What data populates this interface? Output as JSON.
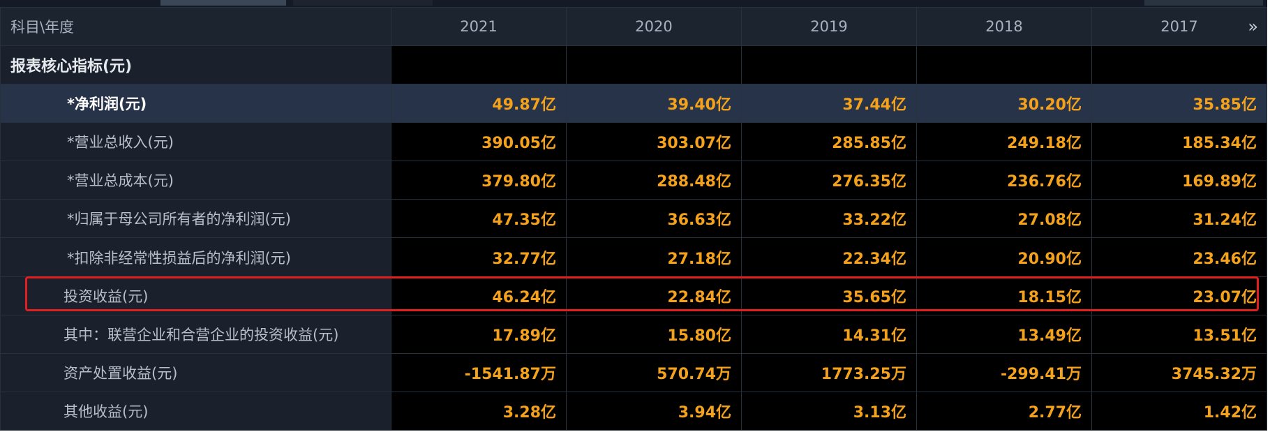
{
  "table": {
    "header_label": "科目\\年度",
    "years": [
      "2021",
      "2020",
      "2019",
      "2018",
      "2017"
    ],
    "more_icon": "»",
    "section_title": "报表核心指标(元)",
    "rows": [
      {
        "label": "*净利润(元)",
        "values": [
          "49.87亿",
          "39.40亿",
          "37.44亿",
          "30.20亿",
          "35.85亿"
        ],
        "highlighted": true
      },
      {
        "label": "*营业总收入(元)",
        "values": [
          "390.05亿",
          "303.07亿",
          "285.85亿",
          "249.18亿",
          "185.34亿"
        ]
      },
      {
        "label": "*营业总成本(元)",
        "values": [
          "379.80亿",
          "288.48亿",
          "276.35亿",
          "236.76亿",
          "169.89亿"
        ]
      },
      {
        "label": "*归属于母公司所有者的净利润(元)",
        "values": [
          "47.35亿",
          "36.63亿",
          "33.22亿",
          "27.08亿",
          "31.24亿"
        ]
      },
      {
        "label": "*扣除非经常性损益后的净利润(元)",
        "values": [
          "32.77亿",
          "27.18亿",
          "22.34亿",
          "20.90亿",
          "23.46亿"
        ]
      },
      {
        "label": "投资收益(元)",
        "values": [
          "46.24亿",
          "22.84亿",
          "35.65亿",
          "18.15亿",
          "23.07亿"
        ],
        "boxed": true
      },
      {
        "label": "其中：联营企业和合营企业的投资收益(元)",
        "values": [
          "17.89亿",
          "15.80亿",
          "14.31亿",
          "13.49亿",
          "13.51亿"
        ]
      },
      {
        "label": "资产处置收益(元)",
        "values": [
          "-1541.87万",
          "570.74万",
          "1773.25万",
          "-299.41万",
          "3745.32万"
        ]
      },
      {
        "label": "其他收益(元)",
        "values": [
          "3.28亿",
          "3.94亿",
          "3.13亿",
          "2.77亿",
          "1.42亿"
        ]
      }
    ]
  },
  "colors": {
    "value_text": "#f4a21c",
    "highlight_row": "#273348",
    "annotation_box": "#e02020"
  }
}
